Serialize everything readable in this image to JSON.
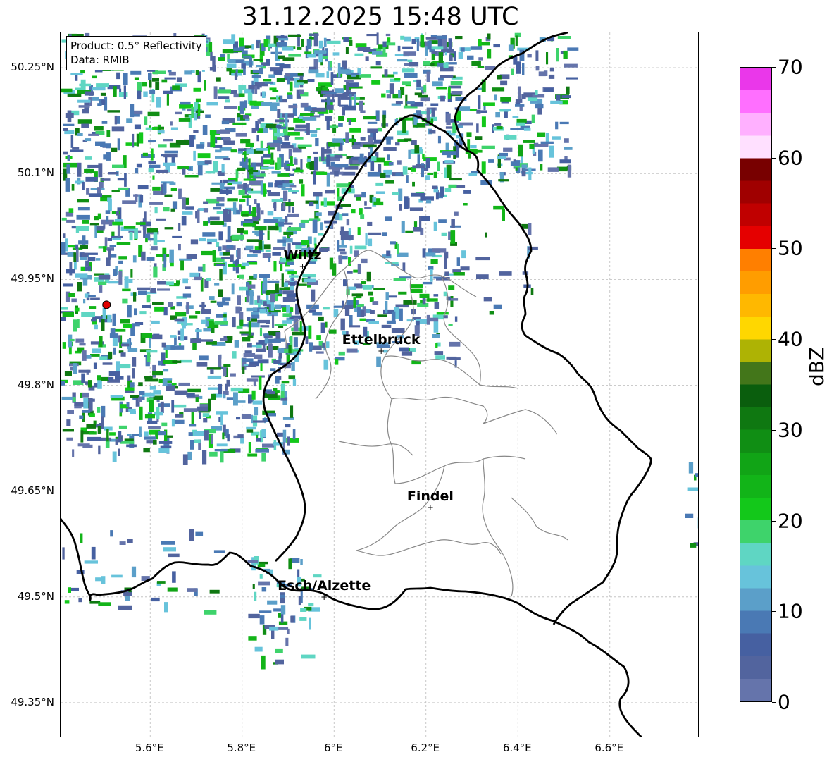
{
  "title": "31.12.2025 15:48 UTC",
  "info": {
    "product": "Product: 0.5° Reflectivity",
    "data": "Data: RMIB"
  },
  "axes": {
    "y_ticks": [
      "50.25°N",
      "50.1°N",
      "49.95°N",
      "49.8°N",
      "49.65°N",
      "49.5°N",
      "49.35°N"
    ],
    "x_ticks": [
      "5.6°E",
      "5.8°E",
      "6°E",
      "6.2°E",
      "6.4°E",
      "6.6°E"
    ],
    "lon_range": [
      5.405,
      6.795
    ],
    "lat_range": [
      49.3,
      50.3
    ]
  },
  "colorbar": {
    "label": "dBZ",
    "min": 0,
    "max": 70,
    "step": 2.5,
    "ticks": [
      "0",
      "10",
      "20",
      "30",
      "40",
      "50",
      "60",
      "70"
    ],
    "colors": [
      "#6574ab",
      "#52649e",
      "#4660a1",
      "#4a79b4",
      "#5b9fc9",
      "#67c3db",
      "#5fd6c3",
      "#3ed36b",
      "#13c81a",
      "#12b418",
      "#11a416",
      "#108e14",
      "#0f7811",
      "#0a5e0d",
      "#43761a",
      "#aeb304",
      "#ffd700",
      "#ffb800",
      "#ff9d00",
      "#ff7f00",
      "#e50000",
      "#c00000",
      "#a00000",
      "#780000",
      "#ffe0ff",
      "#ffb0ff",
      "#ff6fff",
      "#ea37ea"
    ]
  },
  "radar_site": {
    "lon": 5.505,
    "lat": 49.914,
    "color": "#e00000"
  },
  "cities": [
    {
      "name": "Wiltz",
      "lon": 5.933,
      "lat": 49.967
    },
    {
      "name": "Ettelbruck",
      "lon": 6.104,
      "lat": 49.847
    },
    {
      "name": "Findel",
      "lon": 6.211,
      "lat": 49.626
    },
    {
      "name": "Esch/Alzette",
      "lon": 5.98,
      "lat": 49.499
    }
  ]
}
